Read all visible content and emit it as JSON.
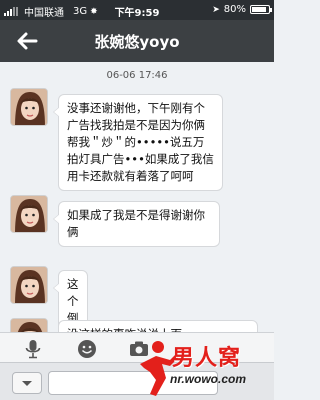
{
  "status_bar": {
    "carrier": "中国联通",
    "network": "3G",
    "time": "下午9:59",
    "battery": "80%"
  },
  "nav": {
    "title": "张婉悠yoyo"
  },
  "chat": {
    "timestamp": "06-06 17:46",
    "messages": [
      {
        "text": "没事还谢谢他，下午刚有个广告找我拍是不是因为你俩帮我＂炒＂的•••••说五万拍灯具广告•••如果成了我信用卡还款就有着落了呵呵"
      },
      {
        "text": "如果成了我是不是得谢谢你俩"
      },
      {
        "text": "这个倒霉社会"
      },
      {
        "text": "没这样的事咋说说上面"
      }
    ]
  },
  "watermark": {
    "text": "男人窝",
    "url": "nr.wowo.com"
  },
  "colors": {
    "nav_bg": "#3c4043",
    "chat_bg": "#eef1f4",
    "bubble_bg": "#ffffff",
    "watermark_red": "#e3201b"
  },
  "icons": [
    "back-arrow-icon",
    "microphone-icon",
    "emoji-icon",
    "camera-icon",
    "chevron-down-icon"
  ]
}
